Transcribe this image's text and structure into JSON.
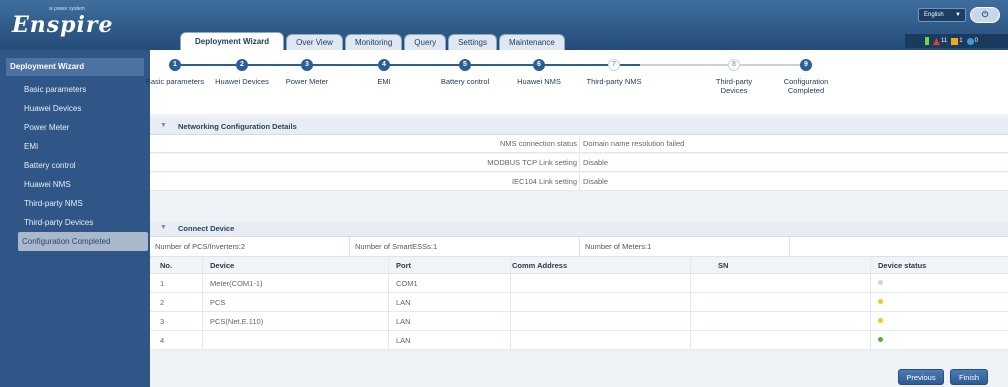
{
  "brand": {
    "name": "Enspire",
    "sub": "w power system"
  },
  "tabs": [
    {
      "label": "Deployment Wizard",
      "active": true
    },
    {
      "label": "Over View",
      "active": false
    },
    {
      "label": "Monitoring",
      "active": false
    },
    {
      "label": "Query",
      "active": false
    },
    {
      "label": "Settings",
      "active": false
    },
    {
      "label": "Maintenance",
      "active": false
    }
  ],
  "top_right": {
    "language": "English",
    "logout_icon": "logout-icon",
    "alarm_counts": {
      "critical": "11",
      "major": "1",
      "minor": "0"
    }
  },
  "sidebar": {
    "title": "Deployment Wizard",
    "items": [
      {
        "label": "Basic parameters"
      },
      {
        "label": "Huawei Devices"
      },
      {
        "label": "Power Meter"
      },
      {
        "label": "EMI"
      },
      {
        "label": "Battery control"
      },
      {
        "label": "Huawei NMS"
      },
      {
        "label": "Third-party NMS"
      },
      {
        "label": "Third-party Devices"
      },
      {
        "label": "Configuration Completed",
        "active": true
      }
    ]
  },
  "steps": [
    {
      "num": "1",
      "label": "Basic parameters",
      "done": true
    },
    {
      "num": "2",
      "label": "Huawei Devices",
      "done": true
    },
    {
      "num": "3",
      "label": "Power Meter",
      "done": true
    },
    {
      "num": "4",
      "label": "EMI",
      "done": true
    },
    {
      "num": "5",
      "label": "Battery control",
      "done": true
    },
    {
      "num": "6",
      "label": "Huawei NMS",
      "done": true
    },
    {
      "num": "7",
      "label": "Third-party NMS",
      "done": false
    },
    {
      "num": "8",
      "label": "Third-party Devices",
      "done": false
    },
    {
      "num": "9",
      "label": "Configuration Completed",
      "done": true
    }
  ],
  "networking": {
    "title": "Networking Configuration Details",
    "rows": [
      {
        "key": "NMS connection status",
        "value": "Domain name resolution failed"
      },
      {
        "key": "MODBUS TCP Link setting",
        "value": "Disable"
      },
      {
        "key": "IEC104 Link setting",
        "value": "Disable"
      }
    ]
  },
  "connect": {
    "title": "Connect Device",
    "counts": [
      "Number of PCS/Inverters:2",
      "Number of SmartESSs:1",
      "Number of Meters:1"
    ],
    "columns": [
      "No.",
      "Device",
      "Port",
      "Comm Address",
      "SN",
      "Device status"
    ],
    "rows": [
      {
        "no": "1",
        "device": "Meter(COM1-1)",
        "port": "COM1",
        "addr": "",
        "sn": "",
        "status": "#cfd4da"
      },
      {
        "no": "2",
        "device": "PCS",
        "port": "LAN",
        "addr": "",
        "sn": "",
        "status": "#f2c81a"
      },
      {
        "no": "3",
        "device": "PCS(Net.E.110)",
        "port": "LAN",
        "addr": "",
        "sn": "",
        "status": "#f2c81a"
      },
      {
        "no": "4",
        "device": "",
        "port": "LAN",
        "addr": "",
        "sn": "",
        "status": "#52b043"
      }
    ]
  },
  "buttons": {
    "previous": "Previous",
    "finish": "Finish"
  },
  "colors": {
    "header": "#2f5686",
    "accent": "#2b5e96"
  }
}
